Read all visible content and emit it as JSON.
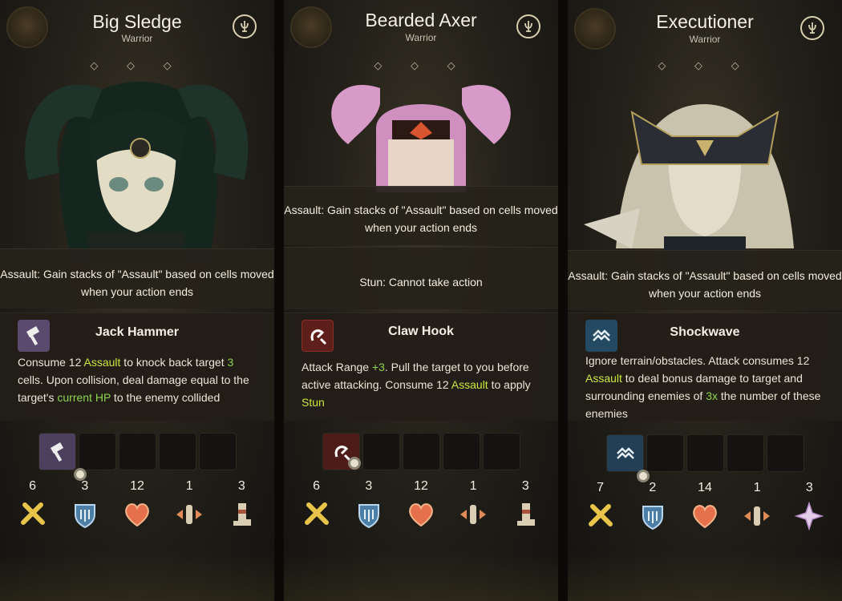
{
  "colors": {
    "highlight": "#c8e83c",
    "panel_bg": "#24211a"
  },
  "cards": [
    {
      "name": "Big Sledge",
      "class": "Warrior",
      "diamonds": "◇ ◇ ◇",
      "tip": "Assault: Gain stacks of \"Assault\" based on cells moved when your action ends",
      "skill_name": "Jack Hammer",
      "skill_icon": "hammer-icon",
      "skill_desc": [
        {
          "t": "Consume 12 "
        },
        {
          "t": "Assault",
          "h": 1
        },
        {
          "t": " to knock back target "
        },
        {
          "t": "3",
          "h": 2
        },
        {
          "t": " cells. Upon collision, deal damage equal to the target's "
        },
        {
          "t": "current HP",
          "h": 2
        },
        {
          "t": " to the enemy collided"
        }
      ],
      "stats": [
        {
          "value": "6",
          "icon": "attack-swords-icon"
        },
        {
          "value": "3",
          "icon": "defense-shield-icon"
        },
        {
          "value": "12",
          "icon": "health-heart-icon"
        },
        {
          "value": "1",
          "icon": "range-arrows-icon"
        },
        {
          "value": "3",
          "icon": "movement-boot-icon"
        }
      ]
    },
    {
      "name": "Bearded Axer",
      "class": "Warrior",
      "diamonds": "◇ ◇ ◇",
      "tip": "Assault: Gain stacks of \"Assault\" based on cells moved when your action ends",
      "tip2": "Stun: Cannot take action",
      "skill_name": "Claw Hook",
      "skill_icon": "hook-icon",
      "skill_desc": [
        {
          "t": "Attack Range "
        },
        {
          "t": "+3",
          "h": 2
        },
        {
          "t": ". Pull the target to you before active attacking. Consume 12 "
        },
        {
          "t": "Assault",
          "h": 1
        },
        {
          "t": " to apply "
        },
        {
          "t": "Stun",
          "h": 1
        }
      ],
      "stats": [
        {
          "value": "6",
          "icon": "attack-swords-icon"
        },
        {
          "value": "3",
          "icon": "defense-shield-icon"
        },
        {
          "value": "12",
          "icon": "health-heart-icon"
        },
        {
          "value": "1",
          "icon": "range-arrows-icon"
        },
        {
          "value": "3",
          "icon": "movement-boot-icon"
        }
      ]
    },
    {
      "name": "Executioner",
      "class": "Warrior",
      "diamonds": "◇ ◇ ◇",
      "tip": "Assault: Gain stacks of \"Assault\" based on cells moved when your action ends",
      "skill_name": "Shockwave",
      "skill_icon": "shockwave-icon",
      "skill_desc": [
        {
          "t": "Ignore terrain/obstacles. Attack consumes 12 "
        },
        {
          "t": "Assault",
          "h": 1
        },
        {
          "t": " to deal bonus damage to target and surrounding enemies of "
        },
        {
          "t": "3x",
          "h": 2
        },
        {
          "t": " the number of these enemies"
        }
      ],
      "stats": [
        {
          "value": "7",
          "icon": "attack-swords-icon"
        },
        {
          "value": "2",
          "icon": "defense-shield-icon"
        },
        {
          "value": "14",
          "icon": "health-heart-icon"
        },
        {
          "value": "1",
          "icon": "range-arrows-icon"
        },
        {
          "value": "3",
          "icon": "movement-star-icon"
        }
      ]
    }
  ]
}
